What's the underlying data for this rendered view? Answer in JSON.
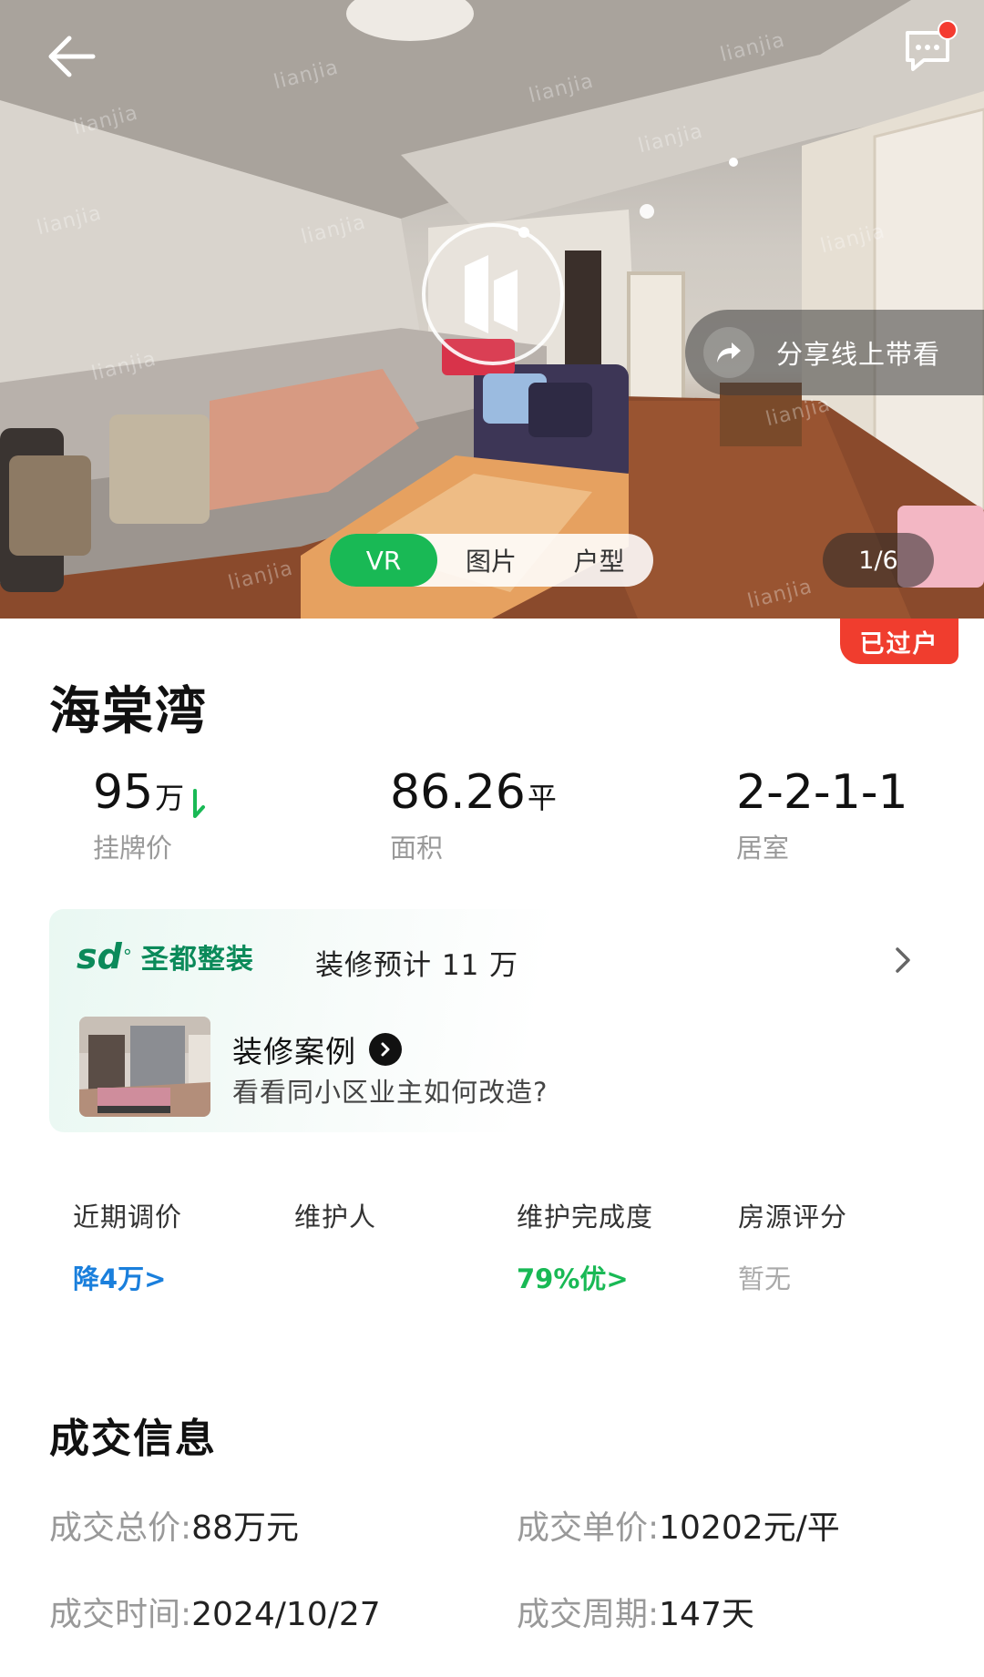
{
  "hero": {
    "watermark": "lianjia",
    "share_label": "分享线上带看",
    "media_tabs": [
      "VR",
      "图片",
      "户型"
    ],
    "counter": "1/6",
    "status_badge": "已过户"
  },
  "listing": {
    "title": "海棠湾",
    "stats": [
      {
        "value": "95",
        "unit": "万",
        "label": "挂牌价",
        "trend": "down"
      },
      {
        "value": "86.26",
        "unit": "平",
        "label": "面积"
      },
      {
        "value": "2-2-1-1",
        "unit": "",
        "label": "居室"
      }
    ]
  },
  "decoration": {
    "brand_logo": "sd",
    "brand_name": "圣都整装",
    "estimate": "装修预计 11 万",
    "case_title": "装修案例",
    "case_subtitle": "看看同小区业主如何改造?"
  },
  "metrics": [
    {
      "label": "近期调价",
      "value": "降4万>"
    },
    {
      "label": "维护人",
      "value": ""
    },
    {
      "label": "维护完成度",
      "value": "79%优>"
    },
    {
      "label": "房源评分",
      "value": "暂无"
    }
  ],
  "deal_info": {
    "title": "成交信息",
    "total_price_key": "成交总价:",
    "total_price": "88万元",
    "unit_price_key": "成交单价:",
    "unit_price": "10202元/平",
    "deal_time_key": "成交时间:",
    "deal_time": "2024/10/27",
    "deal_cycle_key": "成交周期:",
    "deal_cycle": "147天"
  },
  "colors": {
    "primary_green": "#19b955",
    "badge_red": "#f03d2e",
    "link_blue": "#1a7fdc",
    "brand_green": "#0b8a5a"
  },
  "icons": [
    "back-arrow-icon",
    "message-icon",
    "vr-logo-icon",
    "share-icon",
    "trend-down-icon",
    "chevron-right-icon",
    "arrow-circle-icon"
  ]
}
